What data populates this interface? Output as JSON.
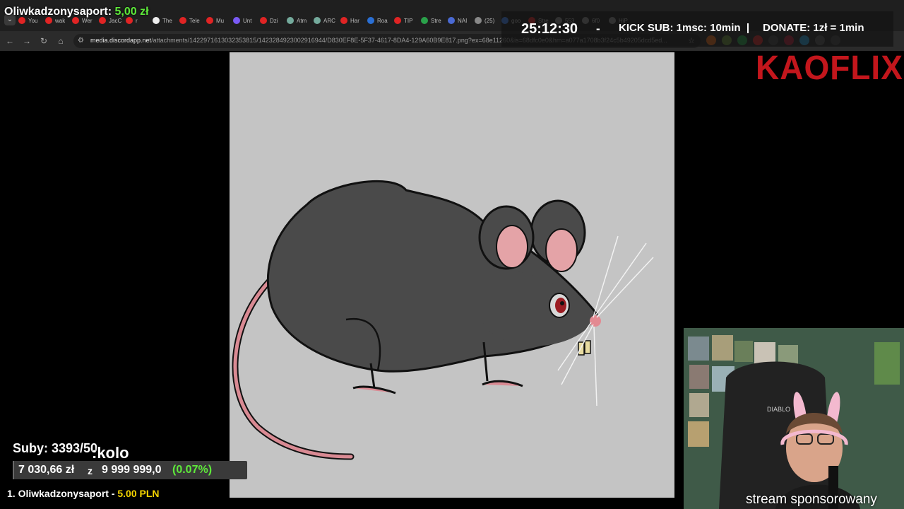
{
  "browser": {
    "tabs": [
      "You",
      "wak",
      "Wer",
      "JacC",
      "r",
      "The",
      "Tele",
      "Mu",
      "Unt",
      "Dzi",
      "Atm",
      "ARC",
      "Har",
      "Roa",
      "TIP",
      "Stre",
      "NAI",
      "(25)",
      "goo",
      "Stre",
      "553",
      "6f0",
      "HiP"
    ],
    "url_domain": "media.discordapp.net",
    "url_path": "/attachments/1422971613032353815/1423284923002916944/D830EF8E-5F37-4617-8DA4-129A60B9E817.png?ex=68e11260&is=68dfc0e0&hm=a077a1708b3f24c5b49205dcd5ed..."
  },
  "overlay": {
    "donor_name": "Oliwkadzonysaport:",
    "donor_amount": "5,00 zł",
    "timer": "25:12:30",
    "timer_dash": "-",
    "kick_sub": "KICK SUB: 1msc: 10min",
    "donate": "DONATE: 1zł = 1min",
    "brand": "KAOFLIX"
  },
  "goal": {
    "subs": "Suby: 3393/50",
    "kolo": ":kolo",
    "current": "7 030,66 zł",
    "separator": "z",
    "target": "9 999 999,0",
    "percent": "(0.07%)",
    "progress_percent": 0.07,
    "top_donor_rank": "1. Oliwkadzonysaport -",
    "top_donor_amount": "5.00 PLN"
  },
  "webcam": {
    "chair_text": "DIABLO",
    "caption": "stream sponsorowany"
  },
  "colors": {
    "green": "#5eea3a",
    "brand_red": "#c3161c",
    "yellow": "#f5d400"
  }
}
